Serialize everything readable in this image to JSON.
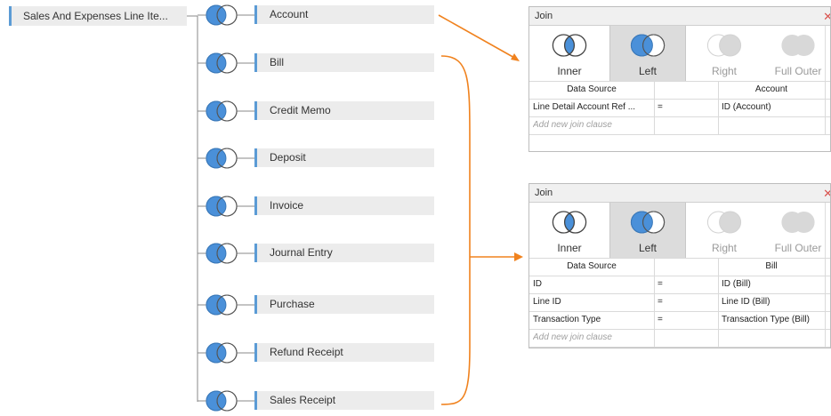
{
  "left_table": "Sales And Expenses Line Ite...",
  "tables": [
    "Account",
    "Bill",
    "Credit Memo",
    "Deposit",
    "Invoice",
    "Journal Entry",
    "Purchase",
    "Refund Receipt",
    "Sales Receipt"
  ],
  "colors": {
    "accent": "#5b9bd5",
    "arrow": "#f0821e",
    "close": "#d9534f"
  },
  "dialog1": {
    "title": "Join",
    "close": "✕",
    "types": [
      "Inner",
      "Left",
      "Right",
      "Full Outer"
    ],
    "selected": "Left",
    "headers": {
      "source": "Data Source",
      "target": "Account"
    },
    "rows": [
      {
        "left": "Line Detail Account Ref ...",
        "op": "=",
        "right": "ID (Account)"
      }
    ],
    "add_clause": "Add new join clause"
  },
  "dialog2": {
    "title": "Join",
    "close": "✕",
    "types": [
      "Inner",
      "Left",
      "Right",
      "Full Outer"
    ],
    "selected": "Left",
    "headers": {
      "source": "Data Source",
      "target": "Bill"
    },
    "rows": [
      {
        "left": "ID",
        "op": "=",
        "right": "ID (Bill)"
      },
      {
        "left": "Line ID",
        "op": "=",
        "right": "Line ID (Bill)"
      },
      {
        "left": "Transaction Type",
        "op": "=",
        "right": "Transaction Type (Bill)"
      }
    ],
    "add_clause": "Add new join clause"
  }
}
